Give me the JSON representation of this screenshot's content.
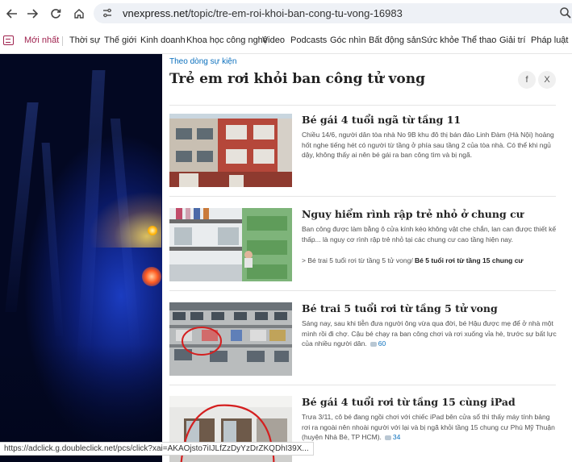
{
  "browser": {
    "url_host": "vnexpress.net",
    "url_path": "/topic/tre-em-roi-khoi-ban-cong-tu-vong-16983",
    "status_url": "https://adclick.g.doubleclick.net/pcs/click?xai=AKAOjsto7iIJLfZzDyYzDrZKQDhI39X..."
  },
  "nav": {
    "items": [
      "Mới nhất",
      "Thời sự",
      "Thế giới",
      "Kinh doanh",
      "Khoa học công nghệ",
      "Video",
      "Podcasts",
      "Góc nhìn",
      "Bất động sản",
      "Sức khỏe",
      "Thể thao",
      "Giải trí",
      "Pháp luật"
    ],
    "accent": "#9f224e"
  },
  "topic": {
    "eyebrow": "Theo dòng sự kiện",
    "title": "Trẻ em rơi khỏi ban công tử vong",
    "share_facebook": "f",
    "share_x": "X"
  },
  "articles": [
    {
      "title": "Bé gái 4 tuổi ngã từ tầng 11",
      "lead": "Chiều 14/6, người dân tòa nhà No 9B khu đô thị bán đảo Linh Đàm (Hà Nội) hoảng hốt nghe tiếng hét có người từ tầng ở phía sau tầng 2 của tòa nhà. Có thể khi ngủ dậy, không thấy ai nên bé gái ra ban công tìm và bị ngã."
    },
    {
      "title": "Nguy hiểm rình rập trẻ nhỏ ở chung cư",
      "lead": "Ban công được làm bằng ô cửa kính kéo không vật che chắn, lan can được thiết kế thấp... là nguy cơ rình rập trẻ nhỏ tại các chung cư cao tầng hiện nay.",
      "related_prefix": "> Bé trai 5 tuổi rơi từ tầng 5 tử vong/ ",
      "related_bold": "Bé 5 tuổi rơi từ tầng 15 chung cư"
    },
    {
      "title": "Bé trai 5 tuổi rơi từ tầng 5 tử vong",
      "lead": "Sáng nay, sau khi tiễn đưa người ông vừa qua đời, bé Hậu được mẹ để ở nhà một mình rồi đi chợ. Cậu bé chạy ra ban công chơi và rơi xuống vỉa hè, trước sự bất lực của nhiều người dân.",
      "comments": "60"
    },
    {
      "title": "Bé gái 4 tuổi rơi từ tầng 15 cùng iPad",
      "lead": "Trưa 3/11, cô bé đang ngồi chơi với chiếc iPad bên cửa sổ thì thấy máy tính bảng rơi ra ngoài nên nhoài người với lại và bị ngã khỏi tầng 15 chung cư Phú Mỹ Thuận (huyện Nhà Bè, TP HCM).",
      "comments": "34"
    }
  ]
}
